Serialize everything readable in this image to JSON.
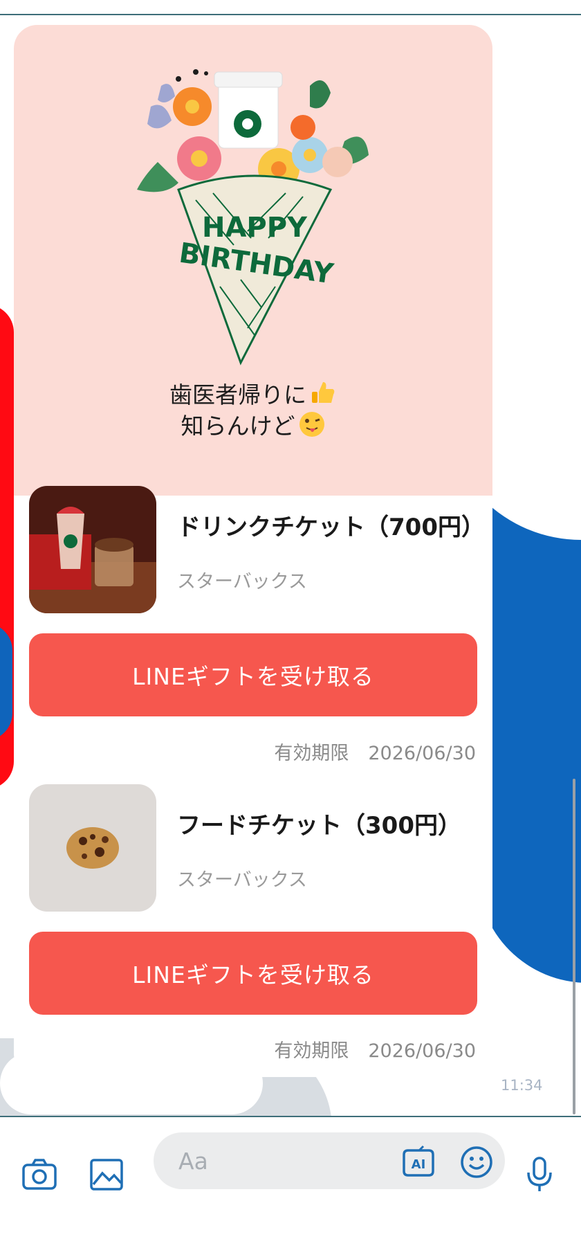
{
  "message": {
    "card_text_line1": "歯医者帰りに",
    "card_text_line2": "知らんけど",
    "bouquet_text_line1": "HAPPY",
    "bouquet_text_line2": "BIRTHDAY",
    "emoji1": "thumbs-up",
    "emoji2": "tongue-face"
  },
  "gifts": [
    {
      "title": "ドリンクチケット（700円）",
      "brand": "スターバックス",
      "button_label": "LINEギフトを受け取る",
      "expiry_label": "有効期限",
      "expiry_date": "2026/06/30",
      "thumbnail": "drink-photo"
    },
    {
      "title": "フードチケット（300円）",
      "brand": "スターバックス",
      "button_label": "LINEギフトを受け取る",
      "expiry_label": "有効期限",
      "expiry_date": "2026/06/30",
      "thumbnail": "cookie-photo"
    }
  ],
  "timestamp": "11:34",
  "composer": {
    "placeholder": "Aa",
    "icons": [
      "camera-icon",
      "image-icon",
      "ai-icon",
      "emoji-icon",
      "mic-icon"
    ]
  },
  "colors": {
    "card_pink": "#fcdcd6",
    "button_red": "#f6574e",
    "brand_green": "#0d6a3b",
    "wallpaper_blue": "#0e66bd",
    "wallpaper_red": "#ff0a13"
  }
}
